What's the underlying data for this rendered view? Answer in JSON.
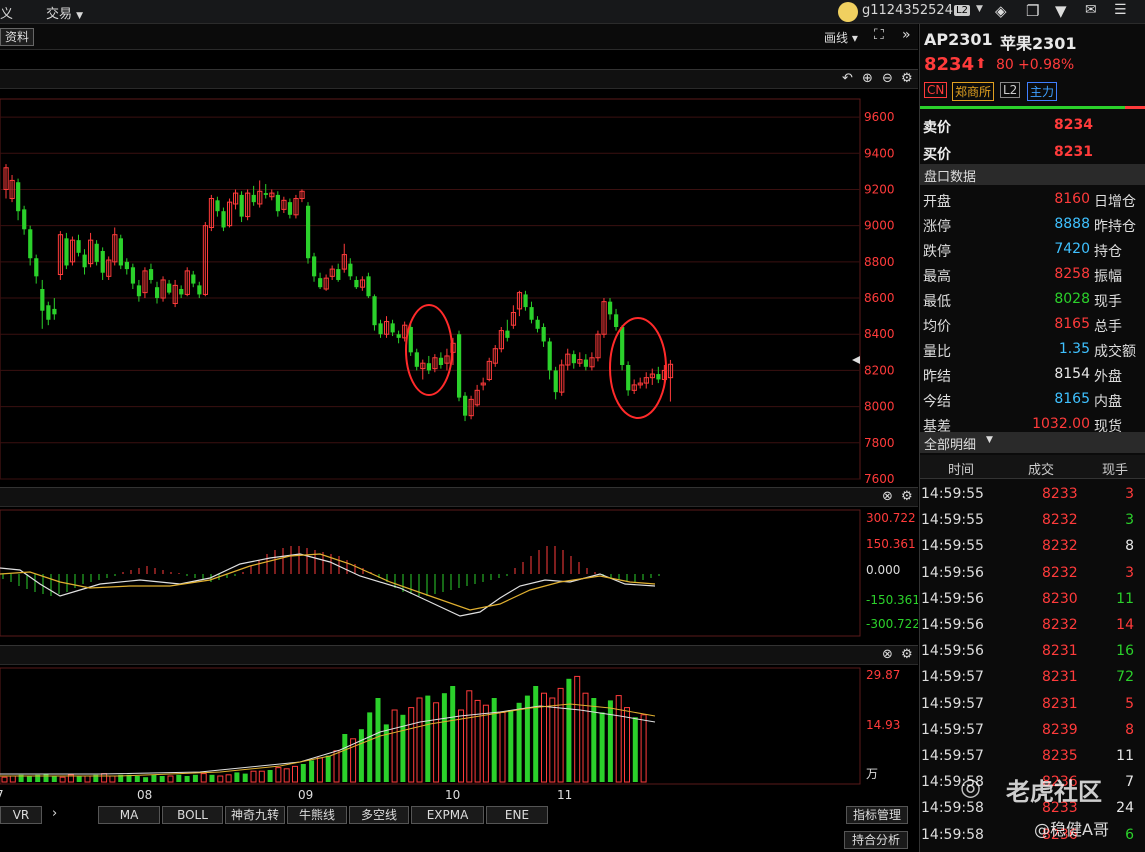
{
  "topbar": {
    "menu_left": "义",
    "menu_trade": "交易",
    "username": "g1124352524",
    "level_badge": "L2"
  },
  "toolbar": {
    "info_tab": "资料",
    "draw_label": "画线"
  },
  "main_chart": {
    "price_ticks": [
      "9600",
      "9400",
      "9200",
      "9000",
      "8800",
      "8600",
      "8400",
      "8200",
      "8000",
      "7800",
      "7600"
    ],
    "month_labels": [
      "7",
      "08",
      "09",
      "10",
      "11"
    ]
  },
  "macd": {
    "ticks": [
      "300.722",
      "150.361",
      "0.000",
      "-150.361",
      "-300.722"
    ]
  },
  "volume": {
    "ticks": [
      "29.87",
      "14.93",
      "万"
    ]
  },
  "indicator_bar": {
    "first": "VR",
    "items": [
      "MA",
      "BOLL",
      "神奇九转",
      "牛熊线",
      "多空线",
      "EXPMA",
      "ENE"
    ],
    "manage": "指标管理",
    "position_analysis": "持合分析"
  },
  "quote": {
    "code": "AP2301",
    "name": "苹果2301",
    "last": "8234",
    "change": "80",
    "change_pct": "+0.98%",
    "tags": [
      "CN",
      "郑商所",
      "L2",
      "主力"
    ],
    "ask_label": "卖价",
    "ask": "8234",
    "bid_label": "买价",
    "bid": "8231",
    "section_title": "盘口数据",
    "rows": [
      {
        "label": "开盘",
        "value": "8160",
        "right": "日增仓",
        "color": "red"
      },
      {
        "label": "涨停",
        "value": "8888",
        "right": "昨持仓",
        "color": "cyan"
      },
      {
        "label": "跌停",
        "value": "7420",
        "right": "持仓",
        "color": "cyan"
      },
      {
        "label": "最高",
        "value": "8258",
        "right": "振幅",
        "color": "red"
      },
      {
        "label": "最低",
        "value": "8028",
        "right": "现手",
        "color": "green"
      },
      {
        "label": "均价",
        "value": "8165",
        "right": "总手",
        "color": "red"
      },
      {
        "label": "量比",
        "value": "1.35",
        "right": "成交额",
        "color": "cyan"
      },
      {
        "label": "昨结",
        "value": "8154",
        "right": "外盘",
        "color": "white"
      },
      {
        "label": "今结",
        "value": "8165",
        "right": "内盘",
        "color": "cyan"
      },
      {
        "label": "基差",
        "value": "1032.00",
        "right": "现货",
        "color": "red"
      }
    ],
    "detail_title": "全部明细",
    "detail_headers": [
      "时间",
      "成交",
      "现手"
    ],
    "ticks": [
      {
        "time": "14:59:55",
        "price": "8233",
        "vol": "3",
        "vc": "red"
      },
      {
        "time": "14:59:55",
        "price": "8232",
        "vol": "3",
        "vc": "green"
      },
      {
        "time": "14:59:55",
        "price": "8232",
        "vol": "8",
        "vc": "white"
      },
      {
        "time": "14:59:56",
        "price": "8232",
        "vol": "3",
        "vc": "red"
      },
      {
        "time": "14:59:56",
        "price": "8230",
        "vol": "11",
        "vc": "green"
      },
      {
        "time": "14:59:56",
        "price": "8232",
        "vol": "14",
        "vc": "red"
      },
      {
        "time": "14:59:56",
        "price": "8231",
        "vol": "16",
        "vc": "green"
      },
      {
        "time": "14:59:57",
        "price": "8231",
        "vol": "72",
        "vc": "green"
      },
      {
        "time": "14:59:57",
        "price": "8231",
        "vol": "5",
        "vc": "red"
      },
      {
        "time": "14:59:57",
        "price": "8239",
        "vol": "8",
        "vc": "red"
      },
      {
        "time": "14:59:57",
        "price": "8235",
        "vol": "11",
        "vc": "white"
      },
      {
        "time": "14:59:58",
        "price": "8236",
        "vol": "7",
        "vc": "white"
      },
      {
        "time": "14:59:58",
        "price": "8233",
        "vol": "24",
        "vc": "white"
      },
      {
        "time": "14:59:58",
        "price": "8236",
        "vol": "6",
        "vc": "green"
      }
    ],
    "watermark_brand": "老虎社区",
    "watermark_user": "@稳健A哥"
  },
  "colors": {
    "up": "#ff3b3b",
    "down": "#2bd12b",
    "grid": "#3a1010",
    "panel": "#0b0b0b"
  },
  "chart_data": {
    "type": "candlestick",
    "title": "",
    "y_range": [
      7600,
      9700
    ],
    "candles": [
      [
        9200,
        9320,
        9150,
        9340
      ],
      [
        9150,
        9250,
        9130,
        9280
      ],
      [
        9240,
        9080,
        9030,
        9260
      ],
      [
        9090,
        8980,
        8950,
        9110
      ],
      [
        8980,
        8820,
        8780,
        9000
      ],
      [
        8820,
        8720,
        8680,
        8840
      ],
      [
        8650,
        8530,
        8430,
        8700
      ],
      [
        8560,
        8480,
        8450,
        8580
      ],
      [
        8540,
        8510,
        8480,
        8600
      ],
      [
        8730,
        8950,
        8700,
        8970
      ],
      [
        8930,
        8780,
        8760,
        8960
      ],
      [
        8800,
        8920,
        8780,
        8940
      ],
      [
        8920,
        8850,
        8830,
        8950
      ],
      [
        8840,
        8770,
        8730,
        8870
      ],
      [
        8790,
        8920,
        8770,
        8960
      ],
      [
        8900,
        8800,
        8780,
        8920
      ],
      [
        8860,
        8740,
        8700,
        8880
      ],
      [
        8720,
        8810,
        8700,
        8830
      ],
      [
        8800,
        8950,
        8780,
        8990
      ],
      [
        8930,
        8780,
        8760,
        8950
      ],
      [
        8800,
        8760,
        8730,
        8820
      ],
      [
        8770,
        8680,
        8650,
        8790
      ],
      [
        8670,
        8610,
        8580,
        8700
      ],
      [
        8630,
        8750,
        8600,
        8770
      ],
      [
        8760,
        8700,
        8680,
        8790
      ],
      [
        8660,
        8600,
        8570,
        8690
      ],
      [
        8600,
        8700,
        8580,
        8720
      ],
      [
        8680,
        8630,
        8620,
        8700
      ],
      [
        8570,
        8670,
        8550,
        8700
      ],
      [
        8650,
        8620,
        8600,
        8670
      ],
      [
        8620,
        8750,
        8610,
        8770
      ],
      [
        8730,
        8680,
        8660,
        8750
      ],
      [
        8670,
        8620,
        8600,
        8690
      ],
      [
        8620,
        9000,
        8610,
        9020
      ],
      [
        8990,
        9150,
        8970,
        9170
      ],
      [
        9140,
        9080,
        9050,
        9160
      ],
      [
        9080,
        8990,
        8970,
        9100
      ],
      [
        9000,
        9130,
        8990,
        9150
      ],
      [
        9120,
        9180,
        9090,
        9200
      ],
      [
        9170,
        9050,
        9020,
        9190
      ],
      [
        9050,
        9180,
        9030,
        9200
      ],
      [
        9170,
        9130,
        9110,
        9220
      ],
      [
        9120,
        9190,
        9100,
        9250
      ],
      [
        9180,
        9170,
        9150,
        9230
      ],
      [
        9160,
        9180,
        9140,
        9200
      ],
      [
        9170,
        9080,
        9050,
        9190
      ],
      [
        9090,
        9140,
        9070,
        9160
      ],
      [
        9130,
        9060,
        9040,
        9150
      ],
      [
        9060,
        9150,
        9040,
        9170
      ],
      [
        9150,
        9190,
        9130,
        9200
      ],
      [
        9110,
        8820,
        8790,
        9130
      ],
      [
        8830,
        8720,
        8690,
        8850
      ],
      [
        8710,
        8660,
        8650,
        8740
      ],
      [
        8650,
        8710,
        8640,
        8730
      ],
      [
        8720,
        8760,
        8700,
        8780
      ],
      [
        8760,
        8700,
        8690,
        8790
      ],
      [
        8760,
        8840,
        8740,
        8900
      ],
      [
        8790,
        8720,
        8700,
        8820
      ],
      [
        8700,
        8660,
        8650,
        8720
      ],
      [
        8660,
        8700,
        8640,
        8720
      ],
      [
        8720,
        8610,
        8600,
        8740
      ],
      [
        8610,
        8450,
        8420,
        8620
      ],
      [
        8460,
        8400,
        8380,
        8480
      ],
      [
        8400,
        8470,
        8380,
        8500
      ],
      [
        8460,
        8410,
        8390,
        8480
      ],
      [
        8400,
        8380,
        8350,
        8420
      ],
      [
        8380,
        8450,
        8360,
        8470
      ],
      [
        8440,
        8300,
        8280,
        8460
      ],
      [
        8300,
        8220,
        8200,
        8320
      ],
      [
        8210,
        8240,
        8150,
        8260
      ],
      [
        8240,
        8200,
        8180,
        8280
      ],
      [
        8210,
        8270,
        8190,
        8290
      ],
      [
        8270,
        8230,
        8210,
        8300
      ],
      [
        8240,
        8280,
        8200,
        8320
      ],
      [
        8300,
        8350,
        8230,
        8380
      ],
      [
        8400,
        8050,
        8030,
        8420
      ],
      [
        8060,
        7950,
        7920,
        8080
      ],
      [
        7950,
        8040,
        7930,
        8060
      ],
      [
        8010,
        8090,
        8000,
        8120
      ],
      [
        8120,
        8130,
        8090,
        8160
      ],
      [
        8150,
        8250,
        8140,
        8270
      ],
      [
        8240,
        8320,
        8220,
        8340
      ],
      [
        8320,
        8420,
        8300,
        8440
      ],
      [
        8420,
        8380,
        8360,
        8480
      ],
      [
        8450,
        8520,
        8430,
        8560
      ],
      [
        8540,
        8630,
        8500,
        8640
      ],
      [
        8620,
        8550,
        8530,
        8640
      ],
      [
        8550,
        8480,
        8460,
        8580
      ],
      [
        8480,
        8430,
        8410,
        8500
      ],
      [
        8440,
        8360,
        8330,
        8460
      ],
      [
        8360,
        8200,
        8150,
        8380
      ],
      [
        8200,
        8080,
        8040,
        8220
      ],
      [
        8080,
        8230,
        8060,
        8260
      ],
      [
        8230,
        8290,
        8200,
        8320
      ],
      [
        8290,
        8240,
        8210,
        8310
      ],
      [
        8240,
        8260,
        8220,
        8300
      ],
      [
        8260,
        8220,
        8200,
        8290
      ],
      [
        8220,
        8270,
        8200,
        8300
      ],
      [
        8270,
        8400,
        8250,
        8420
      ],
      [
        8400,
        8580,
        8380,
        8600
      ],
      [
        8580,
        8510,
        8480,
        8600
      ],
      [
        8510,
        8440,
        8420,
        8540
      ],
      [
        8440,
        8230,
        8200,
        8450
      ],
      [
        8230,
        8090,
        8060,
        8250
      ],
      [
        8090,
        8120,
        8070,
        8150
      ],
      [
        8120,
        8130,
        8100,
        8160
      ],
      [
        8130,
        8160,
        8100,
        8190
      ],
      [
        8160,
        8180,
        8120,
        8210
      ],
      [
        8180,
        8150,
        8130,
        8220
      ],
      [
        8150,
        8200,
        8110,
        8230
      ],
      [
        8160,
        8234,
        8028,
        8258
      ]
    ],
    "annotations": [
      "red circle around consolidation near 8200 (early Oct)",
      "red circle around consolidation near 8150 (Nov end)"
    ]
  }
}
